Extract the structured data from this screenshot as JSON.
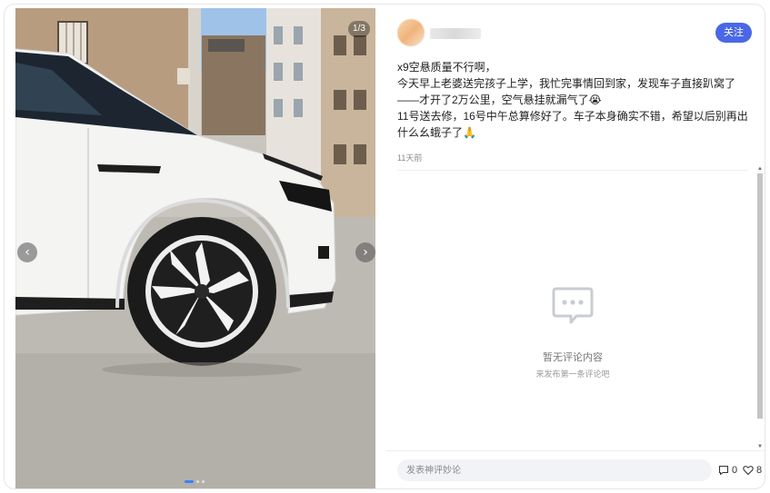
{
  "media": {
    "counter": "1/3",
    "image_description_icon": "photo-white-car-wheel",
    "dots": 3,
    "active_dot": 1
  },
  "author": {
    "name": "",
    "follow_label": "关注"
  },
  "post": {
    "title": "x9空悬质量不行啊，",
    "paragraphs": [
      "今天早上老婆送完孩子上学，我忙完事情回到家，发现车子直接趴窝了——才开了2万公里，空气悬挂就漏气了😭",
      "11号送去修，16号中午总算修好了。车子本身确实不错，希望以后别再出什么幺蛾子了🙏"
    ],
    "time": "11天前"
  },
  "comments": {
    "empty_title": "暂无评论内容",
    "empty_sub": "来发布第一条评论吧",
    "input_placeholder": "发表神评妙论",
    "comment_count": "0",
    "like_count": "8"
  },
  "colors": {
    "accent": "#4a68e6",
    "dot_active": "#3b82f6"
  }
}
